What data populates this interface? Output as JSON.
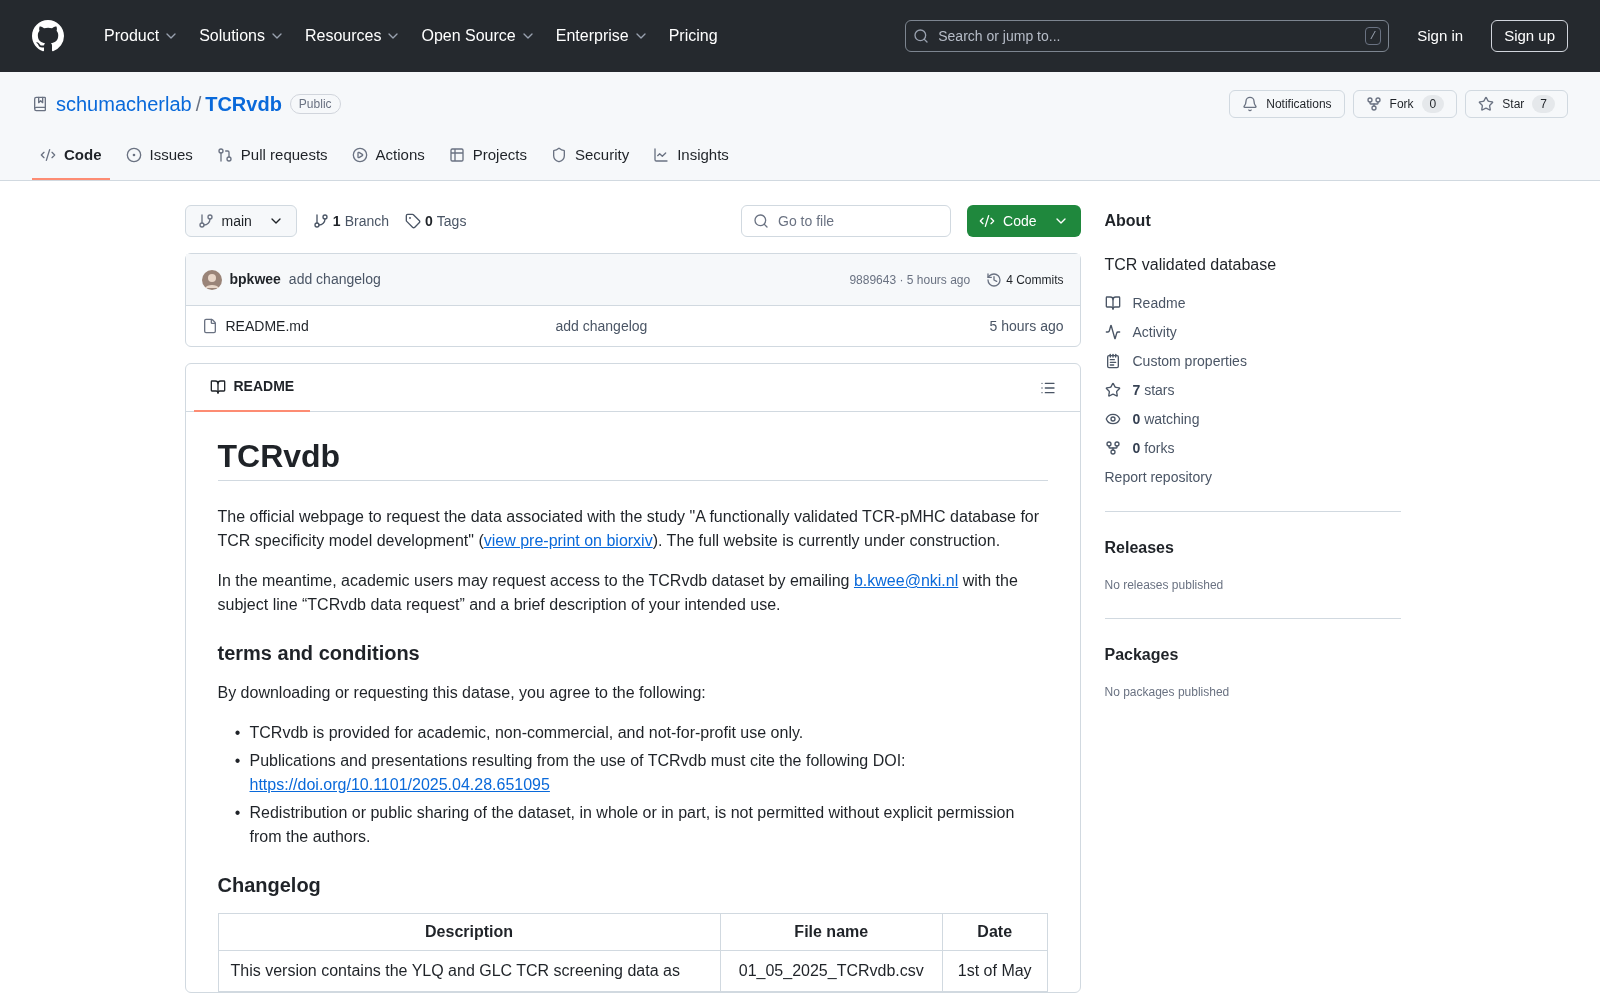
{
  "top_nav": {
    "menus": [
      {
        "label": "Product",
        "has_caret": true
      },
      {
        "label": "Solutions",
        "has_caret": true
      },
      {
        "label": "Resources",
        "has_caret": true
      },
      {
        "label": "Open Source",
        "has_caret": true
      },
      {
        "label": "Enterprise",
        "has_caret": true
      },
      {
        "label": "Pricing",
        "has_caret": false
      }
    ],
    "search": {
      "placeholder": "Search or jump to...",
      "shortcut": "/"
    },
    "sign_in": "Sign in",
    "sign_up": "Sign up"
  },
  "repo": {
    "owner": "schumacherlab",
    "separator": "/",
    "name": "TCRvdb",
    "visibility": "Public",
    "actions": [
      {
        "kind": "notifications",
        "label": "Notifications"
      },
      {
        "kind": "fork",
        "label": "Fork",
        "count": "0"
      },
      {
        "kind": "star",
        "label": "Star",
        "count": "7"
      }
    ]
  },
  "tabs": [
    {
      "kind": "code",
      "label": "Code",
      "selected": true
    },
    {
      "kind": "issues",
      "label": "Issues",
      "selected": false
    },
    {
      "kind": "pulls",
      "label": "Pull requests",
      "selected": false
    },
    {
      "kind": "actions",
      "label": "Actions",
      "selected": false
    },
    {
      "kind": "projects",
      "label": "Projects",
      "selected": false
    },
    {
      "kind": "security",
      "label": "Security",
      "selected": false
    },
    {
      "kind": "insights",
      "label": "Insights",
      "selected": false
    }
  ],
  "toolbar": {
    "branch": "main",
    "branches_count": "1",
    "branches_label": "Branch",
    "tags_count": "0",
    "tags_label": "Tags",
    "file_search": {
      "placeholder": "Go to file"
    },
    "code_button": "Code"
  },
  "commit": {
    "author": "bpkwee",
    "message": "add changelog",
    "meta": "9889643 · 5 hours ago",
    "commits": "4 Commits"
  },
  "files": [
    {
      "name": "README.md",
      "message": "add changelog",
      "time": "5 hours ago"
    }
  ],
  "readme": {
    "tab": "README",
    "title": "TCRvdb",
    "paragraphs": [
      [
        {
          "kind": "text",
          "text": "The official webpage to request the data associated with the study \"A functionally validated TCR-pMHC database for TCR specificity model development\" ("
        },
        {
          "kind": "link",
          "text": "view pre-print on biorxiv"
        },
        {
          "kind": "text",
          "text": "). The full website is currently under construction."
        }
      ],
      [
        {
          "kind": "text",
          "text": "In the meantime, academic users may request access to the TCRvdb dataset by emailing "
        },
        {
          "kind": "link",
          "text": "b.kwee@nki.nl"
        },
        {
          "kind": "text",
          "text": " with the subject line “TCRvdb data request” and a brief description of your intended use."
        }
      ]
    ],
    "terms_heading": "terms and conditions",
    "terms_intro": "By downloading or requesting this datase, you agree to the following:",
    "terms": [
      {
        "marker": "•",
        "segments": [
          {
            "kind": "text",
            "text": "TCRvdb is provided for academic, non-commercial, and not-for-profit use only."
          }
        ]
      },
      {
        "marker": "•",
        "segments": [
          {
            "kind": "text",
            "text": "Publications and presentations resulting from the use of TCRvdb must cite the following DOI: "
          },
          {
            "kind": "link",
            "text": "https://doi.org/10.1101/2025.04.28.651095"
          }
        ]
      },
      {
        "marker": "•",
        "segments": [
          {
            "kind": "text",
            "text": "Redistribution or public sharing of the dataset, in whole or in part, is not permitted without explicit permission from the authors."
          }
        ]
      }
    ],
    "changelog_heading": "Changelog",
    "table": {
      "columns": [
        "Description",
        "File name",
        "Date"
      ],
      "rows": [
        [
          "This version contains the YLQ and GLC TCR screening data as",
          "01_05_2025_TCRvdb.csv",
          "1st of May"
        ]
      ]
    }
  },
  "about": {
    "heading": "About",
    "description": "TCR validated database",
    "items": [
      {
        "kind": "readme",
        "label": "Readme"
      },
      {
        "kind": "activity",
        "label": "Activity"
      },
      {
        "kind": "properties",
        "label": "Custom properties"
      },
      {
        "kind": "stars",
        "count": "7",
        "label": "stars"
      },
      {
        "kind": "watching",
        "count": "0",
        "label": "watching"
      },
      {
        "kind": "forks",
        "count": "0",
        "label": "forks"
      }
    ],
    "report": "Report repository"
  },
  "releases": {
    "heading": "Releases",
    "note": "No releases published"
  },
  "packages": {
    "heading": "Packages",
    "note": "No packages published"
  }
}
